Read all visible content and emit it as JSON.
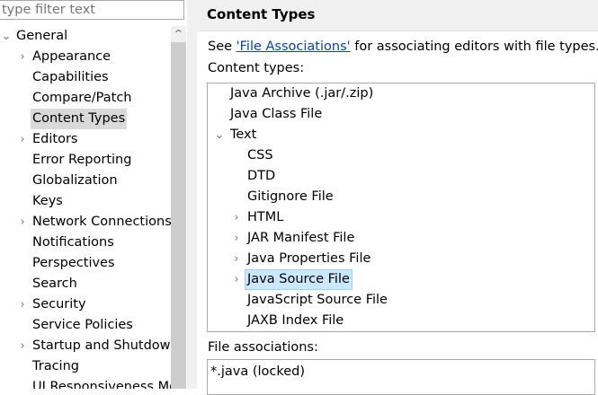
{
  "filter": {
    "placeholder": "type filter text"
  },
  "left_tree": {
    "general": {
      "label": "General",
      "expanded": true
    },
    "items": [
      {
        "label": "Appearance",
        "has_children": true
      },
      {
        "label": "Capabilities",
        "has_children": false
      },
      {
        "label": "Compare/Patch",
        "has_children": false
      },
      {
        "label": "Content Types",
        "has_children": false,
        "selected": true
      },
      {
        "label": "Editors",
        "has_children": true
      },
      {
        "label": "Error Reporting",
        "has_children": false
      },
      {
        "label": "Globalization",
        "has_children": false
      },
      {
        "label": "Keys",
        "has_children": false
      },
      {
        "label": "Network Connections",
        "has_children": true
      },
      {
        "label": "Notifications",
        "has_children": false
      },
      {
        "label": "Perspectives",
        "has_children": false
      },
      {
        "label": "Search",
        "has_children": false
      },
      {
        "label": "Security",
        "has_children": true
      },
      {
        "label": "Service Policies",
        "has_children": false
      },
      {
        "label": "Startup and Shutdown",
        "has_children": true
      },
      {
        "label": "Tracing",
        "has_children": false
      },
      {
        "label": "UI Responsiveness Monitoring",
        "has_children": false
      }
    ]
  },
  "page": {
    "title": "Content Types",
    "desc_prefix": "See ",
    "desc_link": "'File Associations'",
    "desc_suffix": " for associating editors with file types.",
    "content_types_label": "Content types:",
    "file_associations_label": "File associations:"
  },
  "content_types": {
    "top": [
      {
        "label": "Java Archive (.jar/.zip)"
      },
      {
        "label": "Java Class File"
      }
    ],
    "text": {
      "label": "Text",
      "expanded": true
    },
    "text_children": [
      {
        "label": "CSS",
        "has_children": false
      },
      {
        "label": "DTD",
        "has_children": false
      },
      {
        "label": "Gitignore File",
        "has_children": false
      },
      {
        "label": "HTML",
        "has_children": true
      },
      {
        "label": "JAR Manifest File",
        "has_children": true
      },
      {
        "label": "Java Properties File",
        "has_children": true
      },
      {
        "label": "Java Source File",
        "has_children": true,
        "selected": true
      },
      {
        "label": "JavaScript Source File",
        "has_children": false
      },
      {
        "label": "JAXB Index File",
        "has_children": false
      }
    ]
  },
  "file_associations": {
    "items": [
      "*.java (locked)"
    ]
  },
  "icons": {
    "chevron_right": "›",
    "chevron_down": "⌄",
    "scroll_up": "^"
  },
  "colors": {
    "selection_left": "#d9d9d9",
    "selection_right": "#cce8ff",
    "link": "#0645ad",
    "panel_bg": "#f0f0f0"
  }
}
